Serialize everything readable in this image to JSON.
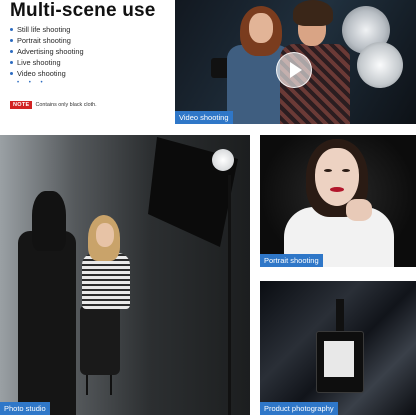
{
  "header": {
    "title": "Multi-scene use",
    "uses": [
      "Still life shooting",
      "Portrait shooting",
      "Advertising shooting",
      "Live shooting",
      "Video shooting"
    ],
    "more": "• • •",
    "note_badge": "NOTE",
    "note_text": "Contains only black cloth."
  },
  "panels": {
    "video": "Video shooting",
    "studio": "Photo studio",
    "portrait": "Portrait shooting",
    "product": "Product photography"
  },
  "colors": {
    "accent": "#2f77c8",
    "note": "#d22323"
  },
  "icons": {
    "video_overlay": "play-icon"
  }
}
